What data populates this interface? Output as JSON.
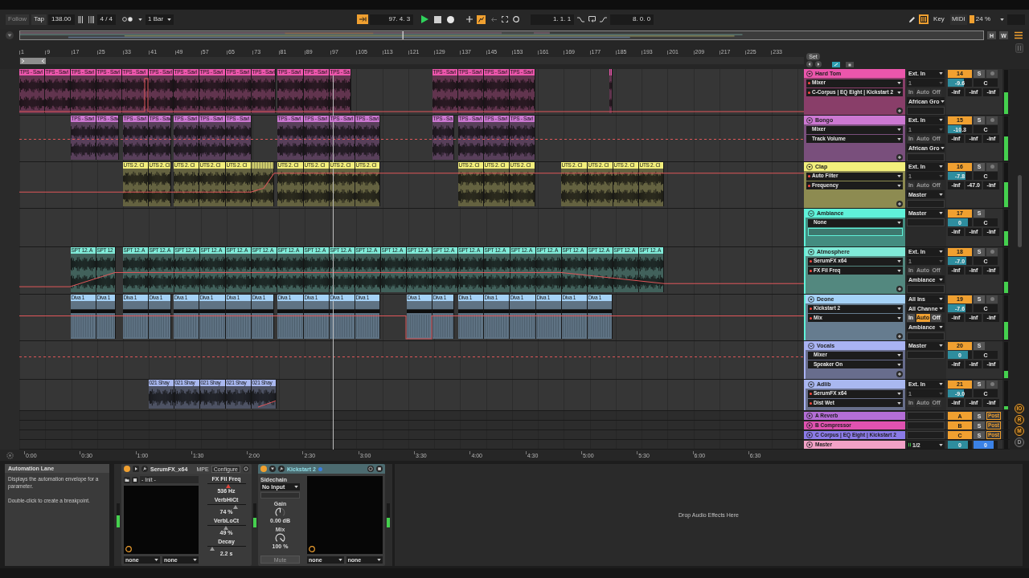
{
  "control_bar": {
    "follow": {
      "label": "Follow",
      "on": false
    },
    "tap": "Tap",
    "tempo": "138.00",
    "time_signature": "4 / 4",
    "quantization": "1 Bar",
    "position_toggle": {
      "on": true
    },
    "arrangement_position": "97. 4. 3",
    "automation_arm": {
      "on": true
    },
    "loop_start": "1. 1. 1",
    "loop_length": "8. 0. 0",
    "computer_keyboard": {
      "on": true
    },
    "key_map": "Key",
    "midi_map": "MIDI",
    "cpu_load": "24 %"
  },
  "overview": {
    "buttons": [
      "H",
      "W"
    ]
  },
  "ruler": {
    "bar_numbers": [
      "1",
      "9",
      "17",
      "25",
      "33",
      "41",
      "49",
      "57",
      "65",
      "73",
      "81",
      "89",
      "97",
      "105",
      "113",
      "121",
      "129",
      "137",
      "145",
      "153",
      "161",
      "169",
      "177",
      "185",
      "193",
      "201",
      "209",
      "217",
      "225",
      "233"
    ],
    "set_button": "Set"
  },
  "tracks": [
    {
      "kind": "audio",
      "name": "Hard Tom",
      "color": "#ec56ac",
      "clips": [
        "TPS - Savi",
        "TPS - Savi",
        "TPS - Savi",
        "TPS - Savi",
        "TPS - Savi",
        "TPS - Savi",
        "TPS - Savi",
        "TPS - Savi",
        "TPS - Savi",
        "TPS - Savi",
        "TPS - Savi",
        "TPS - Savi",
        "TPS - Sa",
        "TPS - Savi",
        "TPS - Savi",
        "TPS - Savi",
        "TPS - Savi"
      ],
      "device": {
        "label": "Mixer",
        "automated": true
      },
      "parameter": {
        "label": "C-Corpus | EQ Eight | Kickstart 2",
        "automated": true
      },
      "input": "Ext. In",
      "input_channel": {
        "label": "1",
        "disabled": true
      },
      "monitor": {
        "disabled": true,
        "options": [
          {
            "label": "In",
            "selected": false
          },
          {
            "label": "Auto",
            "selected": false
          },
          {
            "label": "Off",
            "selected": false
          }
        ]
      },
      "output": "African Gro",
      "number": "14",
      "solo": "S",
      "arm": false,
      "volume": {
        "reading": "-9.6",
        "level": 0.68
      },
      "pan": "C",
      "sends": [
        "-inf",
        "-inf",
        "-inf"
      ],
      "meter": {
        "level": 0.5
      }
    },
    {
      "kind": "audio",
      "name": "Bongo",
      "color": "#cc78d2",
      "clips": [
        "TPS - Savi",
        "TPS - Sav",
        "TPS - Savi",
        "TPS - Sav",
        "TPS - Savi",
        "TPS - Savi",
        "TPS - Savi",
        "TPS - Savi",
        "TPS - Savi",
        "TPS - Savi",
        "TPS - Savi",
        "TPS - Sa",
        "TPS - Savi",
        "TPS - Savi",
        "TPS - Savi"
      ],
      "device": {
        "label": "Mixer",
        "automated": false
      },
      "parameter": {
        "label": "Track Volume",
        "automated": false
      },
      "input": "Ext. In",
      "input_channel": {
        "label": "1",
        "disabled": true
      },
      "monitor": {
        "disabled": true,
        "options": [
          {
            "label": "In",
            "selected": false
          },
          {
            "label": "Auto",
            "selected": false
          },
          {
            "label": "Off",
            "selected": false
          }
        ]
      },
      "output": "African Gro",
      "number": "15",
      "solo": "S",
      "arm": false,
      "volume": {
        "reading": "-10.3",
        "level": 0.58
      },
      "pan": "C",
      "sends": [
        "-inf",
        "-inf",
        "-inf"
      ],
      "meter": {
        "level": 0.55
      }
    },
    {
      "kind": "audio",
      "name": "Clap",
      "color": "#f3ef7c",
      "clips": [
        "UTS 2. Cl",
        "UTS 2. Cl",
        "UTS 2. Cl",
        "UTS 2. Cl",
        "UTS 2. Cl",
        "UTS 2. Cl",
        "UTS 2. Cl",
        "UTS 2. Cl",
        "UTS 2. Cl",
        "UTS 2. Cl",
        "UTS 2. Cl",
        "UTS 2. Cl",
        "UTS 2. Cl",
        "UTS 2. Cl",
        "UTS 2. Cl",
        "UTS 2. Cl"
      ],
      "device": {
        "label": "Auto Filter",
        "automated": true
      },
      "parameter": {
        "label": "Frequency",
        "automated": true
      },
      "input": "Ext. In",
      "input_channel": {
        "label": "1",
        "disabled": true
      },
      "monitor": {
        "disabled": true,
        "options": [
          {
            "label": "In",
            "selected": false
          },
          {
            "label": "Auto",
            "selected": false
          },
          {
            "label": "Off",
            "selected": false
          }
        ]
      },
      "output": "Master",
      "number": "16",
      "solo": "S",
      "arm": false,
      "volume": {
        "reading": "-7.8",
        "level": 0.73
      },
      "pan": "C",
      "sends": [
        "-inf",
        "-47.0",
        "-inf"
      ],
      "meter": {
        "level": 0.57
      }
    },
    {
      "kind": "group",
      "name": "Ambiance",
      "color": "#5ff2d9",
      "device": {
        "label": "None",
        "automated": false
      },
      "output": "Master",
      "number": "17",
      "solo": "S",
      "volume": {
        "reading": "0",
        "level": 0.83
      },
      "pan": "C",
      "sends": [
        "-inf",
        "-inf",
        "-inf"
      ],
      "meter": {
        "level": 0.4
      },
      "children": [
        {
          "kind": "audio",
          "name": "Atmosphere",
          "color": "#80ead8",
          "clips": [
            "SPT 12. A",
            "SPT 12",
            "SPT 12. A",
            "SPT 12. A",
            "SPT 12. A",
            "SPT 12. A",
            "SPT 12. A",
            "SPT 12. A",
            "SPT 12. A",
            "SPT 12. A",
            "SPT 12. A",
            "SPT 12. A",
            "SPT 12. A",
            "SPT 12. A",
            "SPT 12. A",
            "SPT 12. A",
            "SPT 12. A",
            "SPT 12. A",
            "SPT 12. A",
            "SPT 12. A",
            "SPT 12. A",
            "SPT 12. A",
            "SPT 12. A"
          ],
          "device": {
            "label": "SerumFX x64",
            "automated": true
          },
          "parameter": {
            "label": "FX Fil Freq",
            "automated": true
          },
          "input": "Ext. In",
          "input_channel": {
            "label": "1",
            "disabled": true
          },
          "monitor": {
            "disabled": true,
            "options": [
              {
                "label": "In",
                "selected": false
              },
              {
                "label": "Auto",
                "selected": false
              },
              {
                "label": "Off",
                "selected": false
              }
            ]
          },
          "output": "Ambiance",
          "number": "18",
          "solo": "S",
          "arm": false,
          "volume": {
            "reading": "-7.0",
            "level": 0.75
          },
          "pan": "C",
          "sends": [
            "-inf",
            "-inf",
            "-inf"
          ],
          "meter": {
            "level": 0.25
          }
        },
        {
          "kind": "midi",
          "name": "Deone",
          "color": "#a5d2f7",
          "clips": [
            "Diva 1",
            "Diva 1",
            "Diva 1",
            "Diva 1",
            "Diva 1",
            "Diva 1",
            "Diva 1",
            "Diva 1",
            "Diva 1",
            "Diva 1",
            "Diva 1",
            "Diva 1",
            "Diva 1",
            "Diva 1",
            "Diva 1",
            "Diva 1",
            "Diva 1",
            "Diva 1",
            "Diva 1",
            "Diva 1"
          ],
          "device": {
            "label": "Kickstart 2",
            "automated": true
          },
          "parameter": {
            "label": "Mix",
            "automated": true
          },
          "input": "All Ins",
          "input_channel": {
            "label": "All Channe",
            "disabled": false
          },
          "monitor": {
            "disabled": false,
            "options": [
              {
                "label": "In",
                "selected": false
              },
              {
                "label": "Auto",
                "selected": true
              },
              {
                "label": "Off",
                "selected": false
              }
            ]
          },
          "output": "Ambiance",
          "number": "19",
          "solo": "S",
          "arm": false,
          "volume": {
            "reading": "-7.6",
            "level": 0.73
          },
          "pan": "C",
          "sends": [
            "-inf",
            "-inf",
            "-inf"
          ],
          "meter": {
            "level": 0.4
          }
        }
      ]
    },
    {
      "kind": "group",
      "name": "Vocals",
      "color": "#a9b3f3",
      "device": {
        "label": "Mixer",
        "automated": false
      },
      "parameter": {
        "label": "Speaker On",
        "automated": false
      },
      "output": "Master",
      "number": "20",
      "solo": "S",
      "volume": {
        "reading": "0",
        "level": 0.83
      },
      "pan": "C",
      "sends": [
        "-inf",
        "-inf",
        "-inf"
      ],
      "meter": {
        "level": 0.2
      },
      "children": [
        {
          "kind": "audio",
          "name": "Adlib",
          "color": "#a9b8f0",
          "clips": [
            "021 Shay",
            "021 Shay",
            "021 Shay",
            "021 Shay",
            "021 Shay"
          ],
          "device": {
            "label": "SerumFX x64",
            "automated": true
          },
          "parameter": {
            "label": "Dist Wet",
            "automated": true
          },
          "input": "Ext. In",
          "input_channel": {
            "label": "1",
            "disabled": true
          },
          "monitor": {
            "disabled": true,
            "options": [
              {
                "label": "In",
                "selected": false
              },
              {
                "label": "Auto",
                "selected": false
              },
              {
                "label": "Off",
                "selected": false
              }
            ]
          },
          "number": "21",
          "solo": "S",
          "arm": false,
          "volume": {
            "reading": "-9.0",
            "level": 0.68
          },
          "pan": "C",
          "sends": [
            "-inf",
            "-inf",
            "-inf"
          ],
          "meter": {
            "level": 0.12
          }
        }
      ]
    }
  ],
  "return_tracks": [
    {
      "kind": "return",
      "name": "A Reverb",
      "color": "#b46ed6",
      "letter": "A",
      "solo": "S",
      "send_mode": "Post"
    },
    {
      "kind": "return",
      "name": "B Compressor",
      "color": "#e052b0",
      "letter": "B",
      "solo": "S",
      "send_mode": "Post"
    },
    {
      "kind": "return",
      "name": "C Corpus | EQ Eight | Kickstart 2",
      "color": "#8b7be8",
      "letter": "C",
      "solo": "S",
      "send_mode": "Post"
    }
  ],
  "master_track": {
    "kind": "master",
    "name": "Master",
    "color": "#f2a2c6",
    "output": "1/2",
    "volume": {
      "reading": "0",
      "level": 0.83
    },
    "cue": {
      "reading": "0",
      "level": 0.83
    }
  },
  "side_buttons": [
    {
      "label": "IO",
      "on": true
    },
    {
      "label": "R",
      "on": true
    },
    {
      "label": "M",
      "on": true
    },
    {
      "label": "D",
      "on": false
    }
  ],
  "time_ruler": [
    "0:00",
    "0:30",
    "1:00",
    "1:30",
    "2:00",
    "2:30",
    "3:00",
    "3:30",
    "4:00",
    "4:30",
    "5:00",
    "5:30",
    "6:00",
    "6:30"
  ],
  "info_view": {
    "title": "Automation Lane",
    "paragraphs": [
      "Displays the automation envelope for a parameter.",
      "Double-click to create a breakpoint."
    ]
  },
  "device_chain": {
    "input_meter": {
      "level": 0.5
    },
    "devices": [
      {
        "kind": "plugin",
        "name": "SerumFX_x64",
        "selected": false,
        "on": true,
        "mpe": "MPE",
        "configure": "Configure",
        "preset": "- Init -",
        "parameters": [
          {
            "name": "FX Fil Freq",
            "value": "536 Hz",
            "level": 0.55,
            "automated": true
          },
          {
            "name": "VerbHiCt",
            "value": "74 %",
            "level": 0.74,
            "automated": false
          },
          {
            "name": "VerbLoCt",
            "value": "49 %",
            "level": 0.49,
            "automated": false
          },
          {
            "name": "Decay",
            "value": "2.2 s",
            "level": 0.13,
            "automated": false
          }
        ],
        "selectors": [
          "none",
          "none"
        ],
        "output_meter": {
          "level": 0.4
        }
      },
      {
        "kind": "max_device",
        "name": "Kickstart 2",
        "selected": true,
        "on": true,
        "sidechain_label": "Sidechain",
        "sidechain": "No Input",
        "knobs": [
          {
            "name": "Gain",
            "value": "0.00 dB",
            "level": 0.5
          },
          {
            "name": "Mix",
            "value": "100 %",
            "level": 1
          }
        ],
        "mute": {
          "label": "Mute",
          "disabled": true
        },
        "selectors": [
          "none",
          "none"
        ],
        "output_meter": {
          "level": 0.4
        }
      }
    ],
    "drop_hint": "Drop Audio Effects Here"
  }
}
